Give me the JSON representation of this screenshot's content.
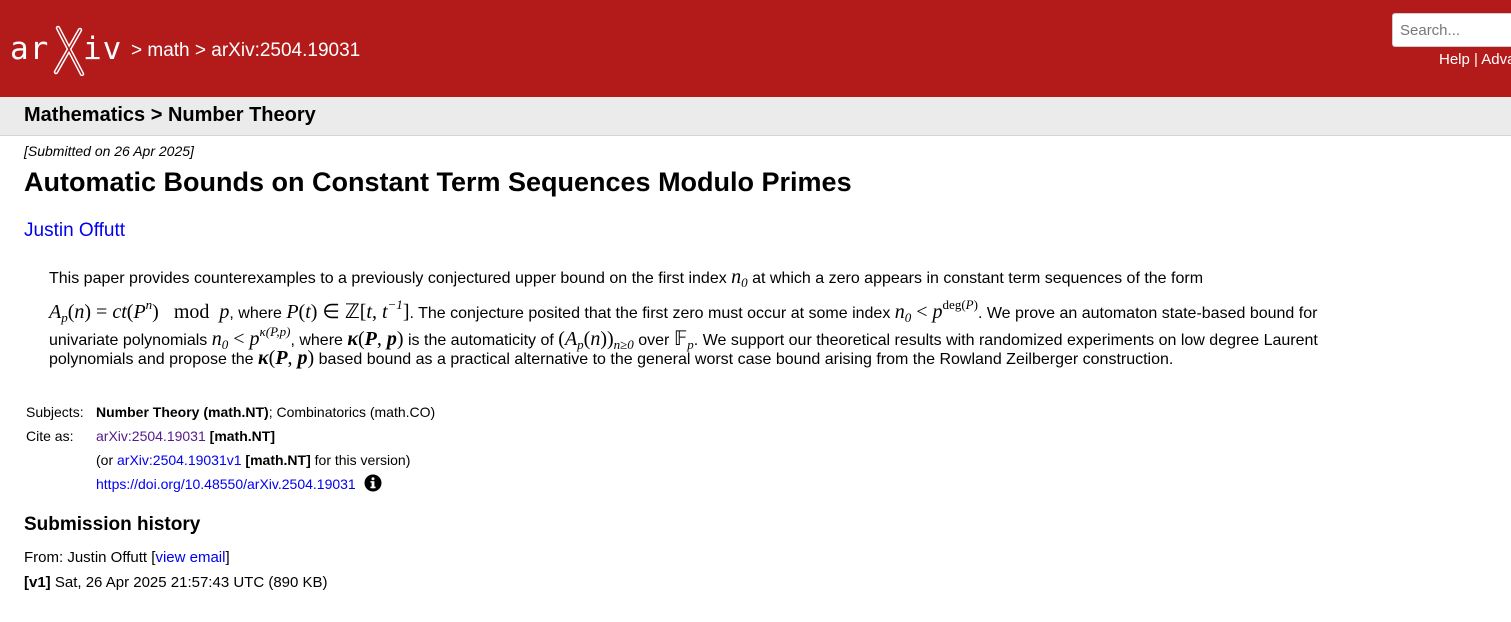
{
  "header": {
    "logo_text": "arXiv",
    "breadcrumb": {
      "sep1": "> ",
      "section": "math",
      "sep2": " > ",
      "paper_id": "arXiv:2504.19031"
    },
    "search_placeholder": "Search...",
    "help": "Help",
    "divider": " | ",
    "advanced": "Adva"
  },
  "subheader": {
    "title": "Mathematics > Number Theory"
  },
  "paper": {
    "submitted": "[Submitted on 26 Apr 2025]",
    "title": "Automatic Bounds on Constant Term Sequences Modulo Primes",
    "author": "Justin Offutt"
  },
  "abstract": {
    "t1": "This paper provides counterexamples to a previously conjectured upper bound on the first index ",
    "t2": " at which a zero appears in constant term sequences of the form",
    "t3": ", where ",
    "t4": ". The conjecture posited that the first zero must occur at some index ",
    "t5": ". We prove an automaton state-based bound for",
    "t6": "univariate polynomials ",
    "t7": ", where ",
    "t8": " is the automaticity of ",
    "t9": " over ",
    "t10": ". We support our theoretical results with randomized experiments on low degree Laurent",
    "t11": "polynomials and propose the ",
    "t12": " based bound as a practical alternative to the general worst case bound arising from the Rowland Zeilberger construction."
  },
  "meta": {
    "subjects_label": "Subjects:",
    "subject_primary": "Number Theory (math.NT)",
    "subject_rest": "; Combinatorics (math.CO)",
    "cite_label": "Cite as:",
    "cite_id": "arXiv:2504.19031",
    "cite_cat": " [math.NT]",
    "or_open": "(or ",
    "version_id": "arXiv:2504.19031v1",
    "version_cat": " [math.NT]",
    "version_tail": " for this version)",
    "doi": "https://doi.org/10.48550/arXiv.2504.19031"
  },
  "history": {
    "title": "Submission history",
    "from_prefix": "From: Justin Offutt [",
    "view_email": "view email",
    "from_suffix": "]",
    "version_tag": "[v1]",
    "version_text": " Sat, 26 Apr 2025 21:57:43 UTC (890 KB)"
  },
  "colors": {
    "header_bg": "#b31b1b",
    "subheader_bg": "#ebebeb",
    "link": "#0000ee",
    "visited_link": "#551a8b"
  },
  "icons": [
    "arxiv-logo",
    "info-icon"
  ]
}
